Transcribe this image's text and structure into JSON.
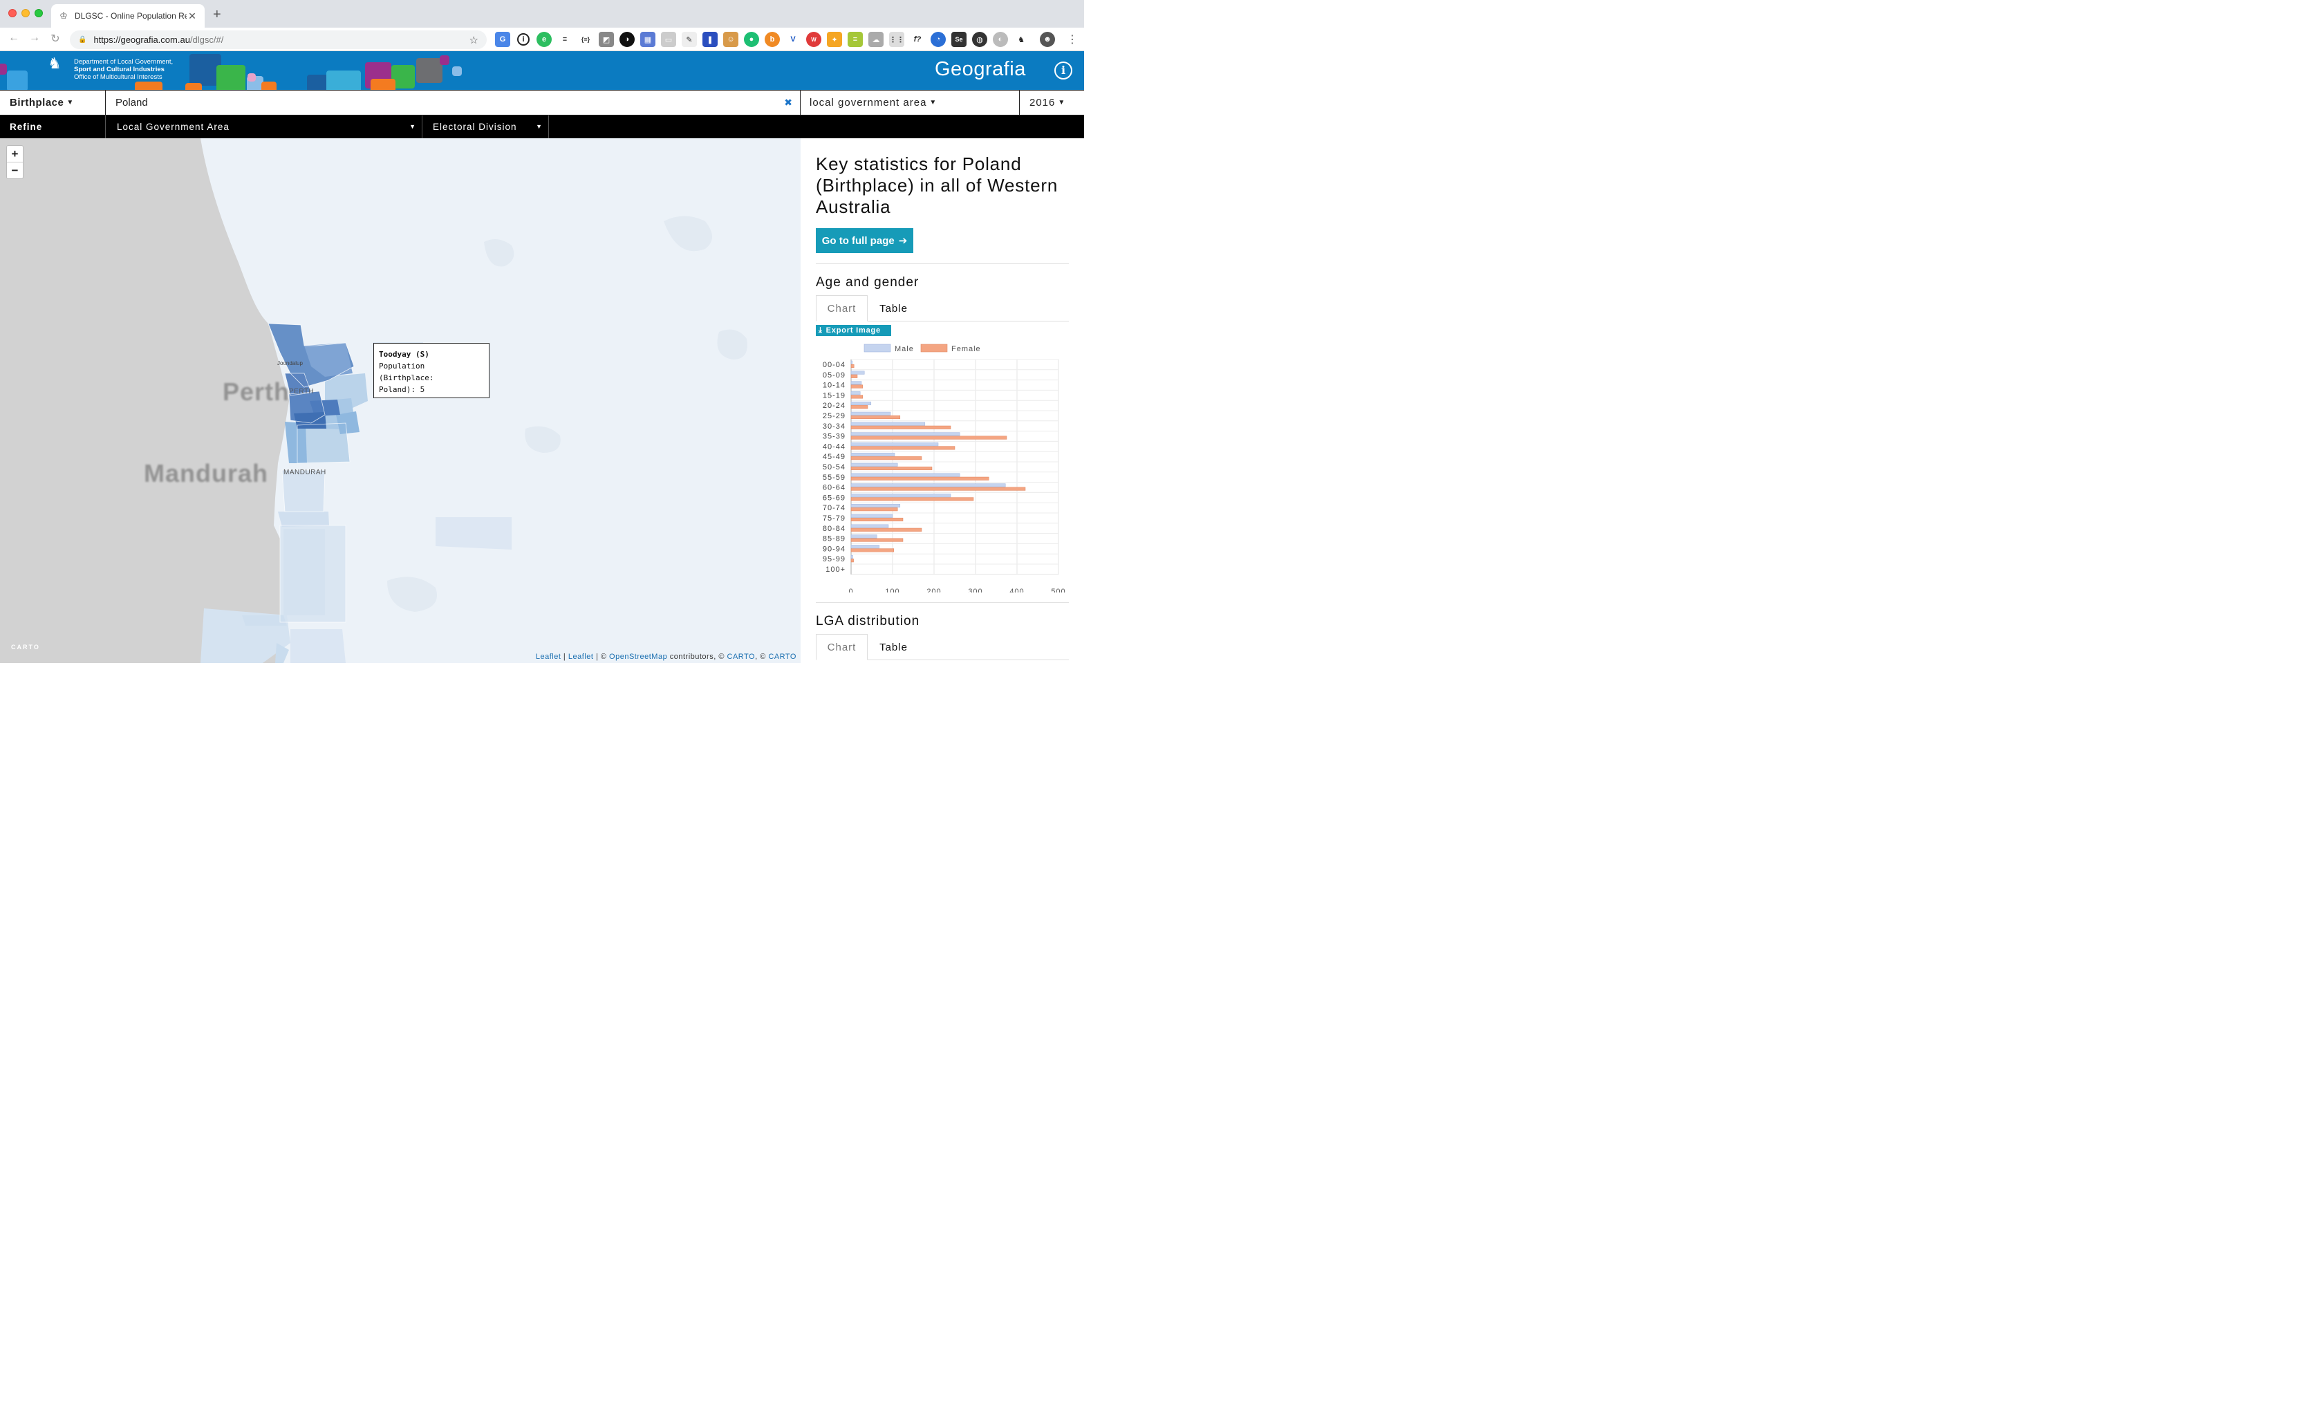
{
  "browser": {
    "tab_title": "DLGSC - Online Population Re",
    "url_host": "https://geografia.com.au",
    "url_path": "/dlgsc/#/"
  },
  "header": {
    "dept_line1": "Department of Local Government,",
    "dept_line2": "Sport and Cultural Industries",
    "dept_line3": "Office of Multicultural Interests",
    "crest_text": "GOVERNMENT OF WESTERN AUSTRALIA",
    "brand": "Geografia"
  },
  "filters": {
    "topic": "Birthplace",
    "search_value": "Poland",
    "geography": "local government area",
    "year": "2016"
  },
  "refine": {
    "label": "Refine",
    "lga": "Local Government Area",
    "electoral": "Electoral Division"
  },
  "map": {
    "zoom_in": "+",
    "zoom_out": "−",
    "city_perth": "Perth",
    "city_perth_small": "PERTH",
    "city_mandurah": "Mandurah",
    "city_mandurah_small": "MANDURAH",
    "suburb_joondalup": "Joondalup",
    "tooltip_title": "Toodyay (S)",
    "tooltip_line1": "Population (Birthplace:",
    "tooltip_line2": "Poland): 5",
    "carto_logo": "CARTO",
    "attribution": {
      "leaflet1": "Leaflet",
      "sep1": " | ",
      "leaflet2": "Leaflet",
      "sep2": " | © ",
      "osm": "OpenStreetMap",
      "contrib": " contributors, © ",
      "carto1": "CARTO",
      "sep3": ", © ",
      "carto2": "CARTO"
    }
  },
  "panel": {
    "title": "Key statistics for Poland (Birthplace) in all of Western Australia",
    "full_page_button": "Go to full page",
    "age_gender_title": "Age and gender",
    "tab_chart": "Chart",
    "tab_table": "Table",
    "export_button": "Export Image",
    "lga_title": "LGA distribution",
    "lga_tab_chart": "Chart",
    "lga_tab_table": "Table"
  },
  "chart_data": {
    "type": "bar",
    "orientation": "horizontal",
    "categories": [
      "00-04",
      "05-09",
      "10-14",
      "15-19",
      "20-24",
      "25-29",
      "30-34",
      "35-39",
      "40-44",
      "45-49",
      "50-54",
      "55-59",
      "60-64",
      "65-69",
      "70-74",
      "75-79",
      "80-84",
      "85-89",
      "90-94",
      "95-99",
      "100+"
    ],
    "series": [
      {
        "name": "Male",
        "color": "#c5d4ef",
        "values": [
          3,
          32,
          25,
          22,
          48,
          95,
          178,
          262,
          210,
          105,
          112,
          262,
          372,
          240,
          118,
          100,
          90,
          62,
          68,
          4,
          0
        ]
      },
      {
        "name": "Female",
        "color": "#f4a582",
        "values": [
          7,
          15,
          28,
          28,
          40,
          118,
          240,
          375,
          250,
          170,
          195,
          332,
          420,
          295,
          112,
          125,
          170,
          125,
          103,
          6,
          0
        ]
      }
    ],
    "xlim": [
      0,
      500
    ],
    "xticks": [
      0,
      100,
      200,
      300,
      400,
      500
    ],
    "legend_position": "top",
    "grid": true
  },
  "colors": {
    "banner": "#0b7bc1",
    "accent_button": "#169bb8",
    "refine_bar": "#000000"
  }
}
